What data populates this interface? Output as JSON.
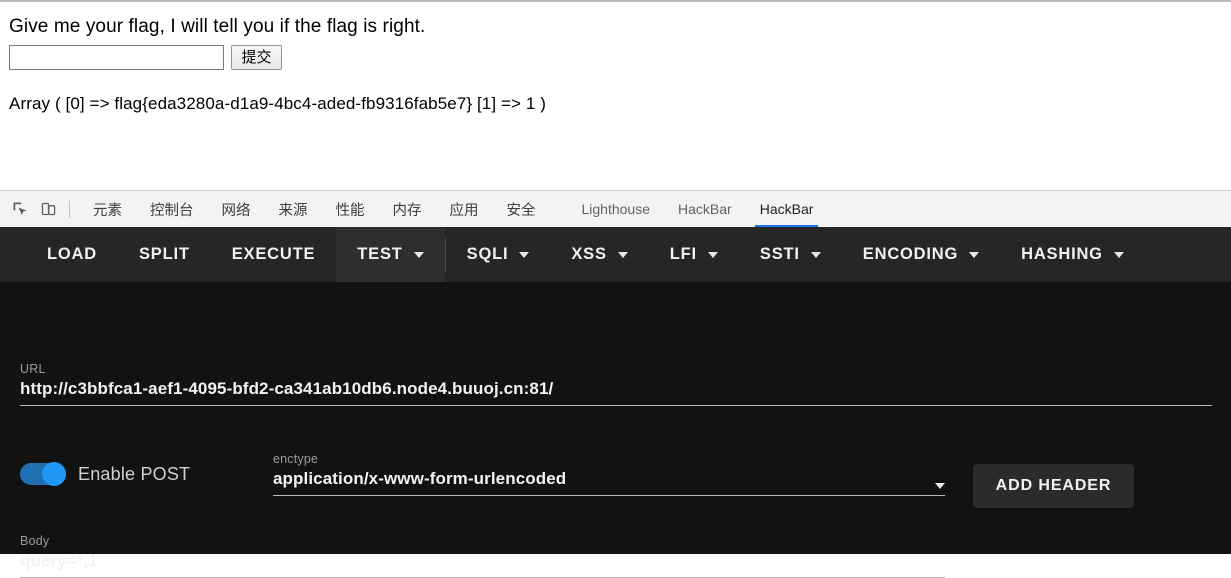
{
  "page": {
    "heading": "Give me your flag, I will tell you if the flag is right.",
    "input_value": "",
    "input_placeholder": "",
    "submit_label": "提交",
    "result": "Array ( [0] => flag{eda3280a-d1a9-4bc4-aded-fb9316fab5e7} [1] => 1 )"
  },
  "devtools": {
    "icons": [
      {
        "name": "inspect-element-icon"
      },
      {
        "name": "device-toolbar-icon"
      }
    ],
    "tabs": [
      {
        "label": "元素",
        "lang": "cn",
        "active": false
      },
      {
        "label": "控制台",
        "lang": "cn",
        "active": false
      },
      {
        "label": "网络",
        "lang": "cn",
        "active": false
      },
      {
        "label": "来源",
        "lang": "cn",
        "active": false
      },
      {
        "label": "性能",
        "lang": "cn",
        "active": false
      },
      {
        "label": "内存",
        "lang": "cn",
        "active": false
      },
      {
        "label": "应用",
        "lang": "cn",
        "active": false
      },
      {
        "label": "安全",
        "lang": "cn",
        "active": false
      },
      {
        "label": "Lighthouse",
        "lang": "en",
        "active": false
      },
      {
        "label": "HackBar",
        "lang": "en",
        "active": false
      },
      {
        "label": "HackBar",
        "lang": "en",
        "active": true
      }
    ],
    "active_tab_underline_color": "#1a73e8"
  },
  "hackbar": {
    "toolbar": [
      {
        "label": "LOAD",
        "has_caret": false,
        "highlight": false
      },
      {
        "label": "SPLIT",
        "has_caret": false,
        "highlight": false
      },
      {
        "label": "EXECUTE",
        "has_caret": false,
        "highlight": false
      },
      {
        "label": "TEST",
        "has_caret": true,
        "highlight": true
      },
      {
        "label": "SQLI",
        "has_caret": true,
        "highlight": false
      },
      {
        "label": "XSS",
        "has_caret": true,
        "highlight": false
      },
      {
        "label": "LFI",
        "has_caret": true,
        "highlight": false
      },
      {
        "label": "SSTI",
        "has_caret": true,
        "highlight": false
      },
      {
        "label": "ENCODING",
        "has_caret": true,
        "highlight": false
      },
      {
        "label": "HASHING",
        "has_caret": true,
        "highlight": false
      }
    ],
    "url": {
      "label": "URL",
      "value": "http://c3bbfca1-aef1-4095-bfd2-ca341ab10db6.node4.buuoj.cn:81/"
    },
    "post": {
      "toggle_label": "Enable POST",
      "toggle_on": true,
      "toggle_color": "#2196f3"
    },
    "enctype": {
      "label": "enctype",
      "value": "application/x-www-form-urlencoded"
    },
    "add_header_label": "ADD HEADER",
    "body": {
      "label": "Body",
      "value": "query=*,1"
    },
    "panel_bg": "#121212",
    "toolbar_bg": "#262626"
  }
}
